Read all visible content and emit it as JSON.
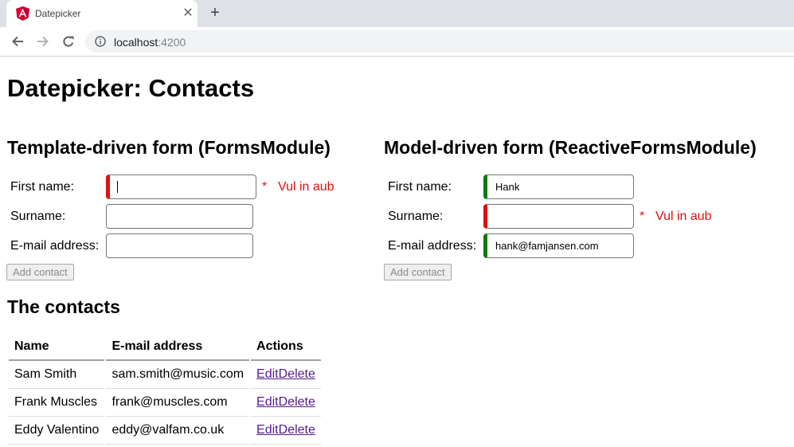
{
  "browser": {
    "tab_title": "Datepicker",
    "new_tab_icon": "plus-icon",
    "url_host": "localhost",
    "url_port": ":4200"
  },
  "page": {
    "title": "Datepicker: Contacts"
  },
  "template_form": {
    "heading": "Template-driven form (FormsModule)",
    "first_name_label": "First name:",
    "first_name_value": "",
    "surname_label": "Surname:",
    "surname_value": "",
    "email_label": "E-mail address:",
    "email_value": "",
    "error_marker": "*",
    "error_text": "Vul in aub",
    "add_button": "Add contact"
  },
  "model_form": {
    "heading": "Model-driven form (ReactiveFormsModule)",
    "first_name_label": "First name:",
    "first_name_value": "Hank",
    "surname_label": "Surname:",
    "surname_value": "",
    "email_label": "E-mail address:",
    "email_value": "hank@famjansen.com",
    "error_marker": "*",
    "error_text": "Vul in aub",
    "add_button": "Add contact"
  },
  "contacts": {
    "heading": "The contacts",
    "columns": [
      "Name",
      "E-mail address",
      "Actions"
    ],
    "rows": [
      {
        "name": "Sam Smith",
        "email": "sam.smith@music.com",
        "edit": "Edit",
        "delete": "Delete"
      },
      {
        "name": "Frank Muscles",
        "email": "frank@muscles.com",
        "edit": "Edit",
        "delete": "Delete"
      },
      {
        "name": "Eddy Valentino",
        "email": "eddy@valfam.co.uk",
        "edit": "Edit",
        "delete": "Delete"
      }
    ]
  },
  "colors": {
    "invalid": "#e01010",
    "valid": "#0a7a0a",
    "link": "#551a8b"
  }
}
